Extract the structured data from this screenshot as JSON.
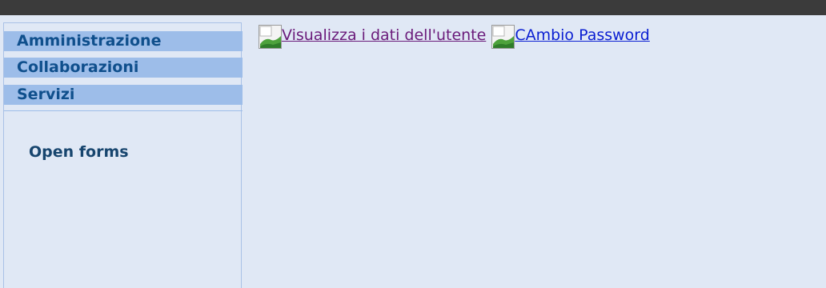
{
  "sidebar": {
    "menu": [
      {
        "label": "Amministrazione"
      },
      {
        "label": "Collaborazioni"
      },
      {
        "label": "Servizi"
      }
    ],
    "section_title": "Open forms"
  },
  "links": [
    {
      "label": "Visualizza i dati dell'utente",
      "icon": "broken-image-icon",
      "state": "visited"
    },
    {
      "label": "CAmbio Password",
      "icon": "broken-image-icon",
      "state": "normal"
    }
  ],
  "colors": {
    "background": "#e0e8f5",
    "menu_bg": "#9dbde9",
    "menu_text": "#0f4f8c",
    "visited_link": "#6a1a7a",
    "link": "#0b1fd2",
    "topbar": "#3b3b3b"
  }
}
